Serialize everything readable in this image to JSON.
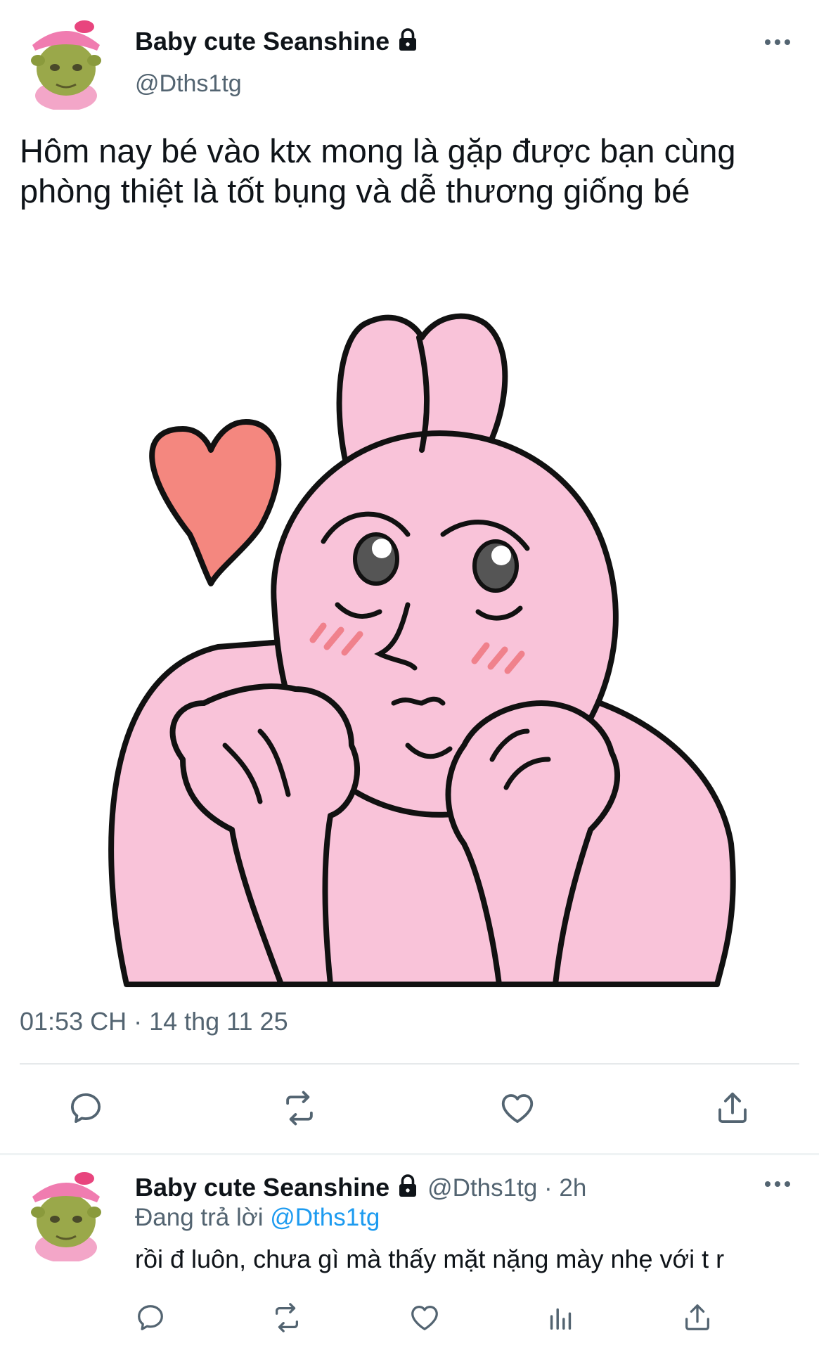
{
  "main_tweet": {
    "display_name": "Baby cute Seanshine",
    "handle": "@Dths1tg",
    "text": "Hôm nay bé vào ktx mong là gặp được bạn cùng phòng thiệt là tốt bụng và dễ thương giống bé",
    "timestamp": "01:53 CH · 14 thg 11 25",
    "actions": [
      "reply-icon",
      "retweet-icon",
      "like-icon",
      "share-icon"
    ]
  },
  "reply_tweet": {
    "display_name": "Baby cute Seanshine",
    "handle": "@Dths1tg",
    "separator": "·",
    "time": "2h",
    "replying_prefix": "Đang trả lời",
    "replying_to": "@Dths1tg",
    "text": "rồi đ luôn, chưa gì mà thấy mặt nặng mày nhẹ với t r",
    "actions": [
      "reply-icon",
      "retweet-icon",
      "like-icon",
      "analytics-icon",
      "share-icon"
    ]
  },
  "colors": {
    "text": "#0f1419",
    "secondary": "#536471",
    "link": "#1d9bf0",
    "sticker_pink": "#f9c3d9",
    "heart": "#f4877f"
  }
}
